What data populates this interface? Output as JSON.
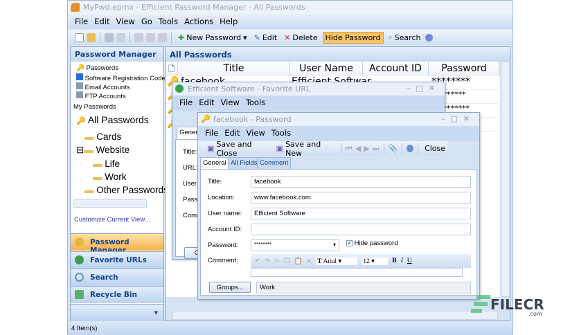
{
  "window": {
    "title": "MyPwd.epmx - Efficient Password Manager - All Passwords"
  },
  "menu": [
    "File",
    "Edit",
    "View",
    "Go",
    "Tools",
    "Actions",
    "Help"
  ],
  "toolbar": {
    "new_password": "New Password",
    "edit": "Edit",
    "delete": "Delete",
    "hide_password": "Hide Password",
    "search": "Search"
  },
  "sidebar": {
    "header": "Password Manager",
    "categories": [
      "Passwords",
      "Software Registration Code:",
      "Email Accounts",
      "FTP Accounts"
    ],
    "my_passwords": "My Passwords",
    "tree": {
      "root": "All Passwords",
      "items": [
        "Cards",
        "Website",
        "Life",
        "Work",
        "Other Passwords"
      ]
    },
    "customize": "Customize Current View...",
    "nav": [
      "Password Manager",
      "Favorite URLs",
      "Search",
      "Recycle Bin"
    ]
  },
  "main": {
    "header": "All Passwords",
    "columns": [
      "Title",
      "User Name",
      "Account ID",
      "Password"
    ],
    "rows": [
      {
        "title": "facebook",
        "user": "Efficient Softwar",
        "account": "",
        "password": "********"
      },
      {
        "title": "",
        "user": "",
        "account": "",
        "password": "*********"
      },
      {
        "title": "",
        "user": "",
        "account": "",
        "password": "**********"
      },
      {
        "title": "",
        "user": "",
        "account": "",
        "password": ""
      }
    ]
  },
  "url_window": {
    "title": "Efficient Software - Favorite URL",
    "menu": [
      "File",
      "Edit",
      "View",
      "Tools"
    ],
    "tab": "Genera",
    "labels": [
      "Title:",
      "URL:",
      "User n",
      "Passw",
      "Comm"
    ],
    "groups_btn": "Gr"
  },
  "pwd_window": {
    "title": "facebook - Password",
    "menu": [
      "File",
      "Edit",
      "View",
      "Tools"
    ],
    "toolbar": {
      "save_close": "Save and Close",
      "save_new": "Save and New",
      "close": "Close"
    },
    "tabs": [
      "General",
      "All Fields",
      "Comment"
    ],
    "fields": {
      "title_label": "Title:",
      "title": "facebook",
      "location_label": "Location:",
      "location": "www.facebook.com",
      "user_label": "User name:",
      "user": "Efficient Software",
      "account_label": "Account ID:",
      "account": "",
      "password_label": "Password:",
      "password": "********",
      "hide_password": "Hide password",
      "comment_label": "Comment:",
      "font": "Arial",
      "size": "12",
      "groups_btn": "Groups...",
      "groups": "Work"
    },
    "format": {
      "bold": "B",
      "italic": "I",
      "underline": "U"
    }
  },
  "status": {
    "items": "4 Item(s)"
  },
  "watermark": {
    "text": "FILECR",
    "sub": ".com"
  }
}
